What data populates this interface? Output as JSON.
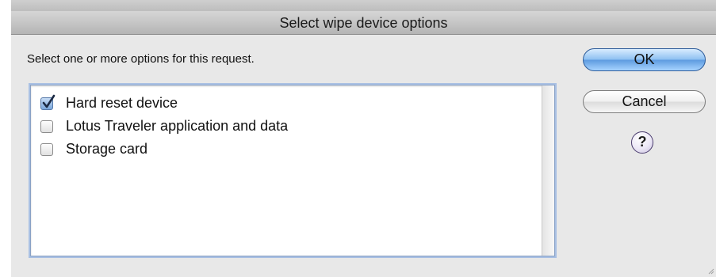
{
  "dialog": {
    "title": "Select wipe device options",
    "instructions": "Select one or more options for this request."
  },
  "options": [
    {
      "label": "Hard reset device",
      "checked": true
    },
    {
      "label": "Lotus Traveler application and data",
      "checked": false
    },
    {
      "label": "Storage card",
      "checked": false
    }
  ],
  "buttons": {
    "ok": "OK",
    "cancel": "Cancel",
    "help": "?"
  },
  "colors": {
    "window_bg": "#e8e8e8",
    "ok_button": "#8fc1f2",
    "list_focus_ring": "#a9c0e3"
  }
}
